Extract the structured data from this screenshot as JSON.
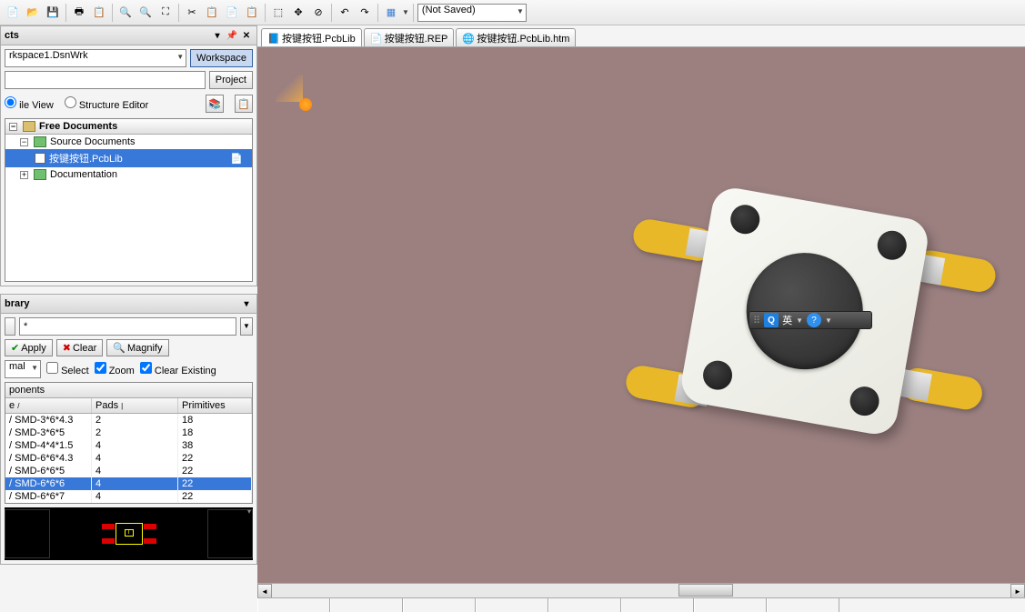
{
  "toolbar": {
    "combo_saved": "(Not Saved)"
  },
  "panels": {
    "projects_title": "cts",
    "library_title": "brary"
  },
  "projects": {
    "workspace_combo": "rkspace1.DsnWrk",
    "btn_workspace": "Workspace",
    "btn_project": "Project",
    "radio_file": "ile View",
    "radio_structure": "Structure Editor",
    "tree": {
      "root": "Free Documents",
      "src": "Source Documents",
      "doc1": "按键按钮.PcbLib",
      "docs": "Documentation"
    }
  },
  "library": {
    "mask": "*",
    "btn_apply": "Apply",
    "btn_clear": "Clear",
    "btn_magnify": "Magnify",
    "combo_mode": "mal",
    "chk_select": "Select",
    "chk_zoom": "Zoom",
    "chk_clear_existing": "Clear Existing",
    "grid_title": "ponents",
    "col_name": "e",
    "col_pads": "Pads",
    "col_primitives": "Primitives",
    "rows": [
      {
        "n": "/ SMD-3*6*4.3",
        "p": "2",
        "pr": "18"
      },
      {
        "n": "/ SMD-3*6*5",
        "p": "2",
        "pr": "18"
      },
      {
        "n": "/ SMD-4*4*1.5",
        "p": "4",
        "pr": "38"
      },
      {
        "n": "/ SMD-6*6*4.3",
        "p": "4",
        "pr": "22"
      },
      {
        "n": "/ SMD-6*6*5",
        "p": "4",
        "pr": "22"
      },
      {
        "n": "/ SMD-6*6*6",
        "p": "4",
        "pr": "22"
      },
      {
        "n": "/ SMD-6*6*7",
        "p": "4",
        "pr": "22"
      }
    ],
    "selected_row": 5
  },
  "tabs": [
    {
      "label": "按键按钮.PcbLib",
      "icon": "pcb"
    },
    {
      "label": "按键按钮.REP",
      "icon": "txt"
    },
    {
      "label": "按键按钮.PcbLib.htm",
      "icon": "htm"
    }
  ],
  "ime": {
    "q": "Q",
    "lang": "英",
    "help": "?"
  }
}
